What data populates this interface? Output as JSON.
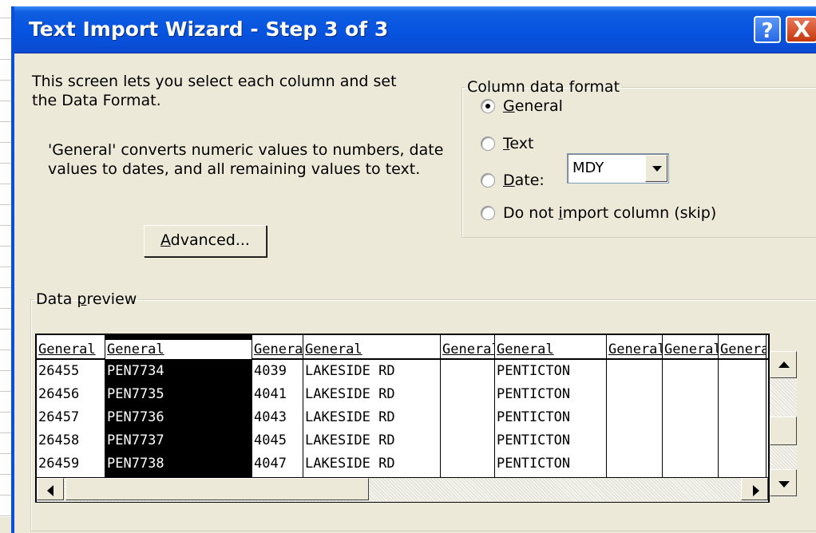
{
  "window": {
    "title": "Text Import Wizard - Step 3 of 3",
    "help_label": "?",
    "close_label": "X"
  },
  "description": {
    "line1": "This screen lets you select each column and set\nthe Data Format.",
    "line2": "'General' converts numeric values to numbers, date\nvalues to dates, and all remaining values to text."
  },
  "column_format": {
    "legend": "Column data format",
    "options": [
      {
        "label_accel": "G",
        "label_rest": "eneral",
        "checked": true
      },
      {
        "label_accel": "T",
        "label_rest": "ext",
        "checked": false
      },
      {
        "label_accel": "D",
        "label_rest": "ate:",
        "checked": false
      },
      {
        "label_pre": "Do not ",
        "label_accel": "i",
        "label_rest": "mport column (skip)",
        "checked": false
      }
    ],
    "date_format": "MDY"
  },
  "advanced_button": {
    "accel": "A",
    "rest": "dvanced..."
  },
  "preview": {
    "legend_pre": "Data ",
    "legend_accel": "p",
    "legend_rest": "review",
    "selected_column": 1,
    "columns": [
      {
        "header": "General",
        "cells": [
          "26455",
          "26456",
          "26457",
          "26458",
          "26459"
        ]
      },
      {
        "header": "General",
        "cells": [
          "PEN7734",
          "PEN7735",
          "PEN7736",
          "PEN7737",
          "PEN7738"
        ]
      },
      {
        "header": "General",
        "cells": [
          "4039",
          "4041",
          "4043",
          "4045",
          "4047"
        ]
      },
      {
        "header": "General",
        "cells": [
          "LAKESIDE RD",
          "LAKESIDE RD",
          "LAKESIDE RD",
          "LAKESIDE RD",
          "LAKESIDE RD"
        ]
      },
      {
        "header": "General",
        "cells": [
          "",
          "",
          "",
          "",
          ""
        ]
      },
      {
        "header": "General",
        "cells": [
          "PENTICTON",
          "PENTICTON",
          "PENTICTON",
          "PENTICTON",
          "PENTICTON"
        ]
      },
      {
        "header": "General",
        "cells": [
          "",
          "",
          "",
          "",
          ""
        ]
      },
      {
        "header": "General",
        "cells": [
          "",
          "",
          "",
          "",
          ""
        ]
      },
      {
        "header": "General",
        "cells": [
          "",
          "",
          "",
          "",
          ""
        ]
      }
    ]
  },
  "icons": {
    "up": "scroll-up-arrow-icon",
    "down": "scroll-down-arrow-icon",
    "left": "scroll-left-arrow-icon",
    "right": "scroll-right-arrow-icon",
    "combo": "chevron-down-icon"
  }
}
